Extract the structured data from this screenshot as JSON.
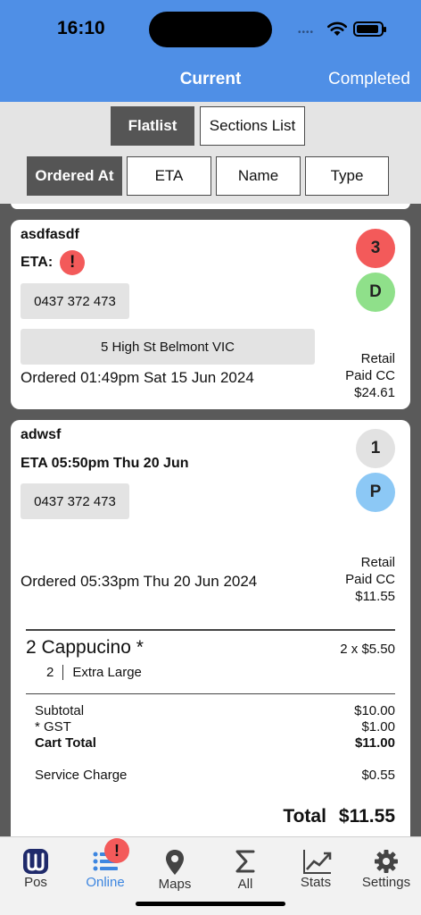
{
  "status": {
    "time": "16:10"
  },
  "header": {
    "tab_current": "Current",
    "tab_completed": "Completed"
  },
  "view_toggle": {
    "flatlist": "Flatlist",
    "sections": "Sections List"
  },
  "sort": {
    "ordered_at": "Ordered At",
    "eta": "ETA",
    "name": "Name",
    "type": "Type"
  },
  "orders": [
    {
      "name": "asdfasdf",
      "eta_label": "ETA:",
      "eta_alert": "!",
      "phone": "0437 372 473",
      "address": "5 High St Belmont VIC",
      "ordered": "Ordered 01:49pm Sat 15 Jun 2024",
      "count": "3",
      "status_letter": "D",
      "type": "Retail",
      "payment": "Paid CC",
      "amount": "$24.61"
    },
    {
      "name": "adwsf",
      "eta": "ETA 05:50pm Thu 20 Jun",
      "phone": "0437 372 473",
      "ordered": "Ordered 05:33pm Thu 20 Jun 2024",
      "count": "1",
      "status_letter": "P",
      "type": "Retail",
      "payment": "Paid CC",
      "amount": "$11.55",
      "item": {
        "name": "2 Cappucino *",
        "price": "2 x $5.50",
        "mod_qty": "2",
        "mod_name": "Extra Large"
      },
      "summary": {
        "subtotal_label": "Subtotal",
        "subtotal": "$10.00",
        "gst_label": "* GST",
        "gst": "$1.00",
        "cart_total_label": "Cart Total",
        "cart_total": "$11.00",
        "service_label": "Service Charge",
        "service": "$0.55",
        "total_label": "Total",
        "total": "$11.55"
      }
    }
  ],
  "tabbar": {
    "pos": "Pos",
    "online": "Online",
    "maps": "Maps",
    "all": "All",
    "stats": "Stats",
    "settings": "Settings",
    "online_badge": "!"
  },
  "colors": {
    "header_blue": "#4f8fe6",
    "alert_red": "#f35a5a",
    "delivery_green": "#8fe08a",
    "pickup_blue": "#8cc8f5",
    "count_grey": "#e2e2e2"
  }
}
